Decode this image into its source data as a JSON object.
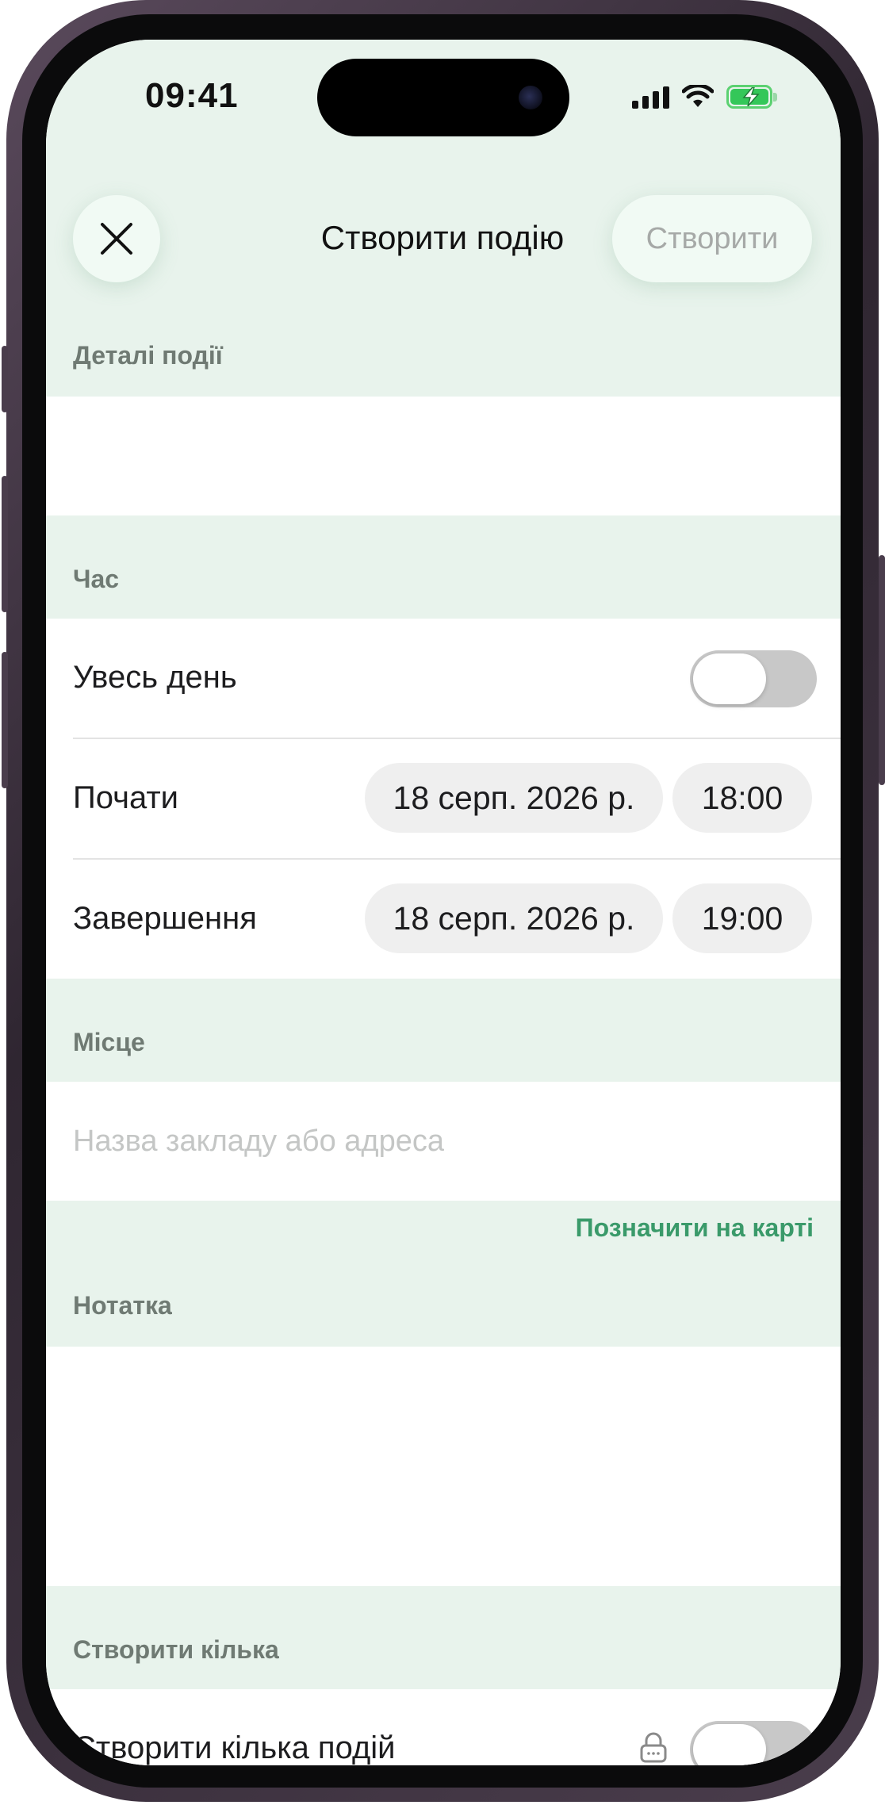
{
  "status_bar": {
    "time": "09:41"
  },
  "nav": {
    "title": "Створити подію",
    "create_label": "Створити"
  },
  "sections": {
    "details": {
      "label": "Деталі події"
    },
    "time": {
      "label": "Час",
      "all_day_label": "Увесь день",
      "all_day_on": false,
      "start_label": "Почати",
      "start_date": "18 серп. 2026 р.",
      "start_time": "18:00",
      "end_label": "Завершення",
      "end_date": "18 серп. 2026 р.",
      "end_time": "19:00"
    },
    "place": {
      "label": "Місце",
      "placeholder": "Назва закладу або адреса",
      "map_link": "Позначити на карті"
    },
    "note": {
      "label": "Нотатка"
    },
    "multiple": {
      "label": "Створити кілька",
      "toggle_label": "Створити кілька подій",
      "toggle_on": false
    }
  },
  "colors": {
    "section_bg": "#e8f3ec",
    "accent": "#3a9a6a",
    "battery": "#34c759"
  }
}
